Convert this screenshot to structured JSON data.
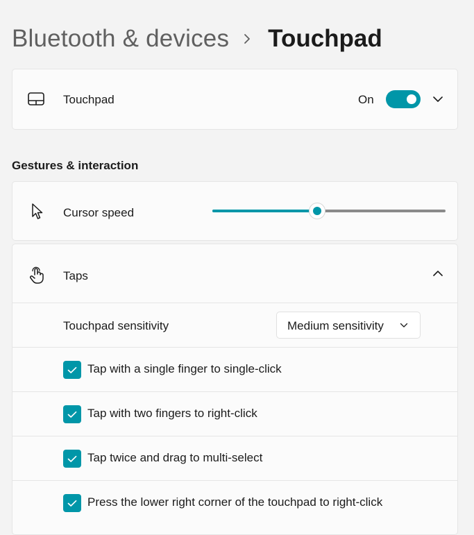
{
  "header": {
    "parent": "Bluetooth & devices",
    "current": "Touchpad"
  },
  "touchpad": {
    "label": "Touchpad",
    "state": "On",
    "enabled": true
  },
  "gestures": {
    "title": "Gestures & interaction",
    "cursor_speed": {
      "label": "Cursor speed",
      "value_fraction": 0.45
    },
    "taps": {
      "label": "Taps",
      "expanded": true,
      "sensitivity_label": "Touchpad sensitivity",
      "sensitivity_value": "Medium sensitivity",
      "options": [
        {
          "label": "Tap with a single finger to single-click",
          "checked": true
        },
        {
          "label": "Tap with two fingers to right-click",
          "checked": true
        },
        {
          "label": "Tap twice and drag to multi-select",
          "checked": true
        },
        {
          "label": "Press the lower right corner of the touchpad to right-click",
          "checked": true
        }
      ]
    }
  },
  "colors": {
    "accent": "#0096a8",
    "background": "#f3f3f3",
    "card": "#fbfbfb"
  },
  "icons": {
    "touchpad": "touchpad-icon",
    "cursor": "cursor-arrow-icon",
    "taps": "tap-hand-icon",
    "breadcrumb": "chevron-right-icon"
  }
}
